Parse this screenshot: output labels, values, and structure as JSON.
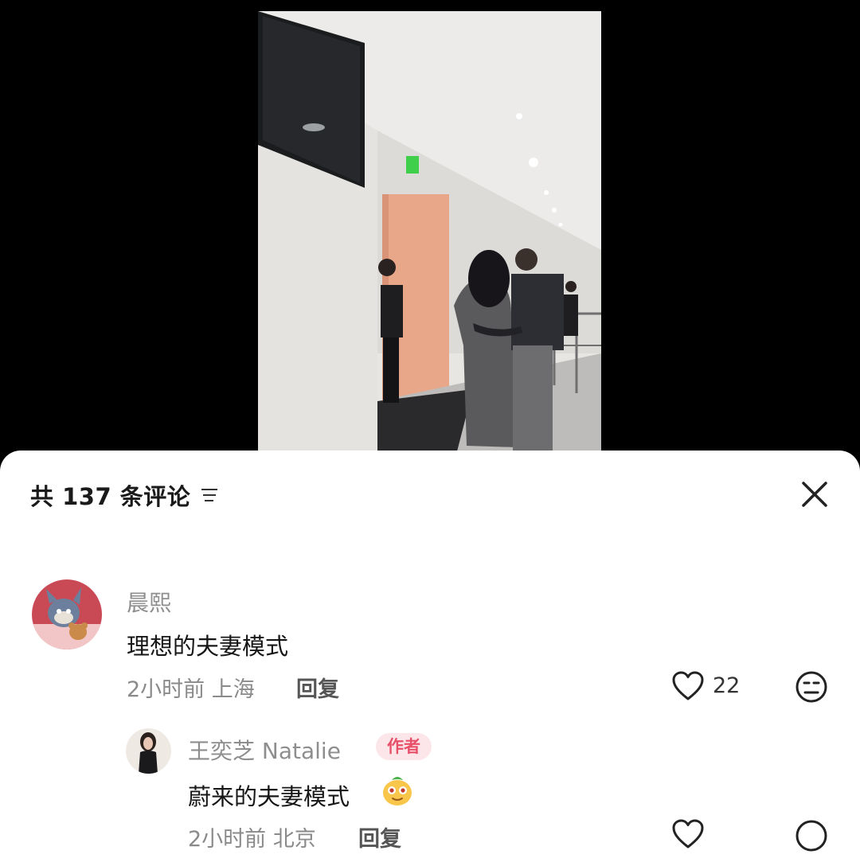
{
  "header": {
    "comment_count_label": "共 137 条评论"
  },
  "icons": {
    "sort": "sort-lines-icon",
    "close": "close-icon",
    "like": "heart-outline-icon",
    "dislike": "meh-face-icon",
    "emoji": "cartoon-face-emoji"
  },
  "comments": [
    {
      "nickname": "晨熙",
      "text": "理想的夫妻模式",
      "time": "2小时前",
      "location": "上海",
      "reply_label": "回复",
      "likes": "22",
      "replies": [
        {
          "nickname": "王奕芝 Natalie",
          "badge": "作者",
          "text": "蔚来的夫妻模式",
          "time": "2小时前",
          "location": "北京",
          "reply_label": "回复"
        }
      ]
    }
  ],
  "colors": {
    "badge_bg": "#fde6ea",
    "badge_text": "#e8506a",
    "sheet_bg": "#ffffff",
    "backdrop": "#000000"
  }
}
